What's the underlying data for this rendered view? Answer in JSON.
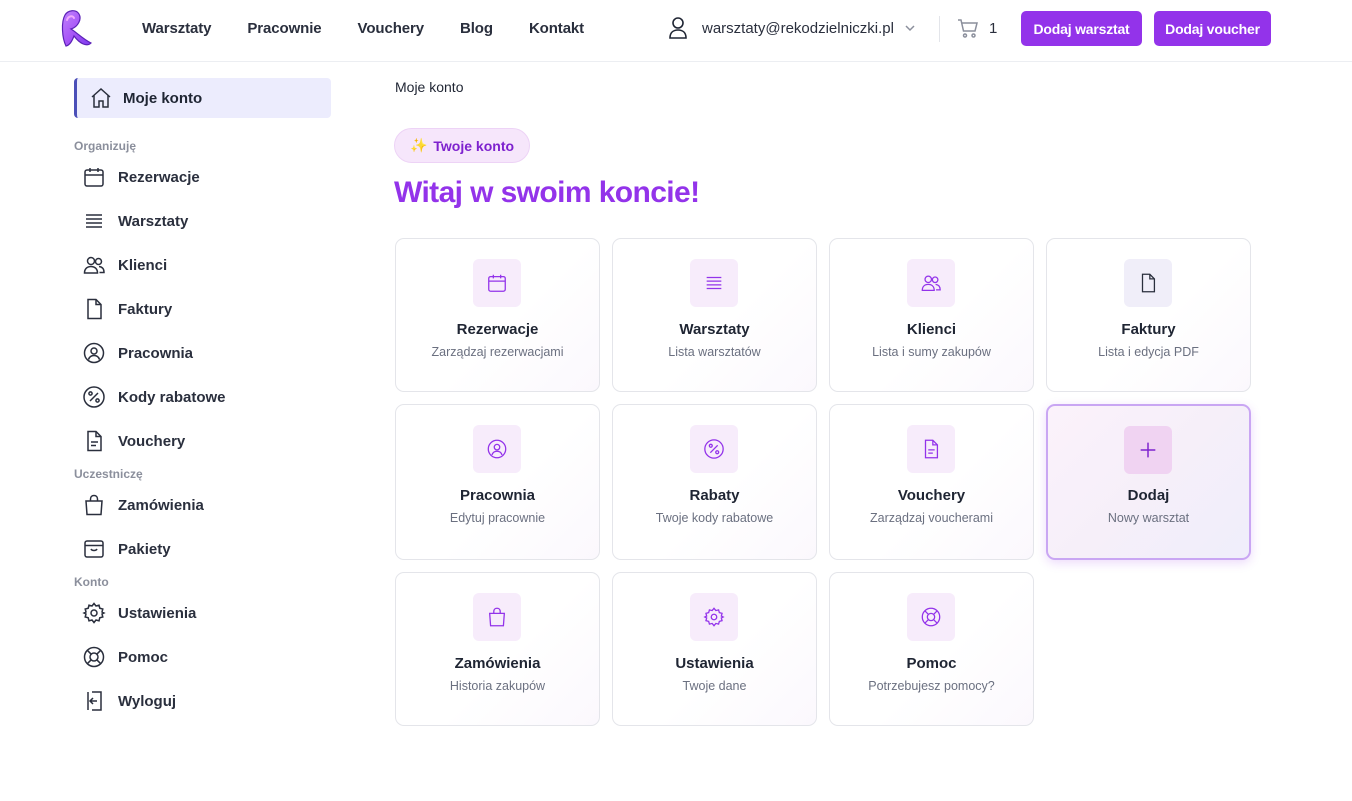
{
  "header": {
    "nav": [
      "Warsztaty",
      "Pracownie",
      "Vouchery",
      "Blog",
      "Kontakt"
    ],
    "user_email": "warsztaty@rekodzielniczki.pl",
    "cart_count": "1",
    "add_workshop_label": "Dodaj warsztat",
    "add_voucher_label": "Dodaj voucher"
  },
  "sidebar": {
    "active_label": "Moje konto",
    "groups": {
      "organize": "Organizuję",
      "participate": "Uczestniczę",
      "account": "Konto"
    },
    "items": [
      {
        "label": "Rezerwacje",
        "icon": "calendar-icon"
      },
      {
        "label": "Warsztaty",
        "icon": "list-icon"
      },
      {
        "label": "Klienci",
        "icon": "users-icon"
      },
      {
        "label": "Faktury",
        "icon": "file-icon"
      },
      {
        "label": "Pracownia",
        "icon": "user-circle-icon"
      },
      {
        "label": "Kody rabatowe",
        "icon": "percent-icon"
      },
      {
        "label": "Vouchery",
        "icon": "file-text-icon"
      },
      {
        "label": "Zamówienia",
        "icon": "shopping-bag-icon"
      },
      {
        "label": "Pakiety",
        "icon": "package-icon"
      },
      {
        "label": "Ustawienia",
        "icon": "gear-icon"
      },
      {
        "label": "Pomoc",
        "icon": "lifebuoy-icon"
      },
      {
        "label": "Wyloguj",
        "icon": "logout-icon"
      }
    ]
  },
  "main": {
    "breadcrumb": "Moje konto",
    "pill_label": "Twoje konto",
    "pill_icon": "sparkles-icon",
    "headline": "Witaj w swoim koncie!",
    "cards": [
      {
        "title": "Rezerwacje",
        "subtitle": "Zarządzaj rezerwacjami",
        "icon": "calendar-icon"
      },
      {
        "title": "Warsztaty",
        "subtitle": "Lista warsztatów",
        "icon": "list-icon"
      },
      {
        "title": "Klienci",
        "subtitle": "Lista i sumy zakupów",
        "icon": "users-icon"
      },
      {
        "title": "Faktury",
        "subtitle": "Lista i edycja PDF",
        "icon": "file-icon"
      },
      {
        "title": "Pracownia",
        "subtitle": "Edytuj pracownie",
        "icon": "user-circle-icon"
      },
      {
        "title": "Rabaty",
        "subtitle": "Twoje kody rabatowe",
        "icon": "percent-icon"
      },
      {
        "title": "Vouchery",
        "subtitle": "Zarządzaj voucherami",
        "icon": "file-text-icon"
      },
      {
        "title": "Dodaj",
        "subtitle": "Nowy warsztat",
        "icon": "plus-icon"
      },
      {
        "title": "Zamówienia",
        "subtitle": "Historia zakupów",
        "icon": "shopping-bag-icon"
      },
      {
        "title": "Ustawienia",
        "subtitle": "Twoje dane",
        "icon": "gear-icon"
      },
      {
        "title": "Pomoc",
        "subtitle": "Potrzebujesz pomocy?",
        "icon": "lifebuoy-icon"
      }
    ]
  },
  "colors": {
    "accent": "#9333ea",
    "accent_dark": "#7e22ce",
    "sidebar_active_bg": "#ececfd",
    "sidebar_active_border": "#4b4fb8"
  }
}
